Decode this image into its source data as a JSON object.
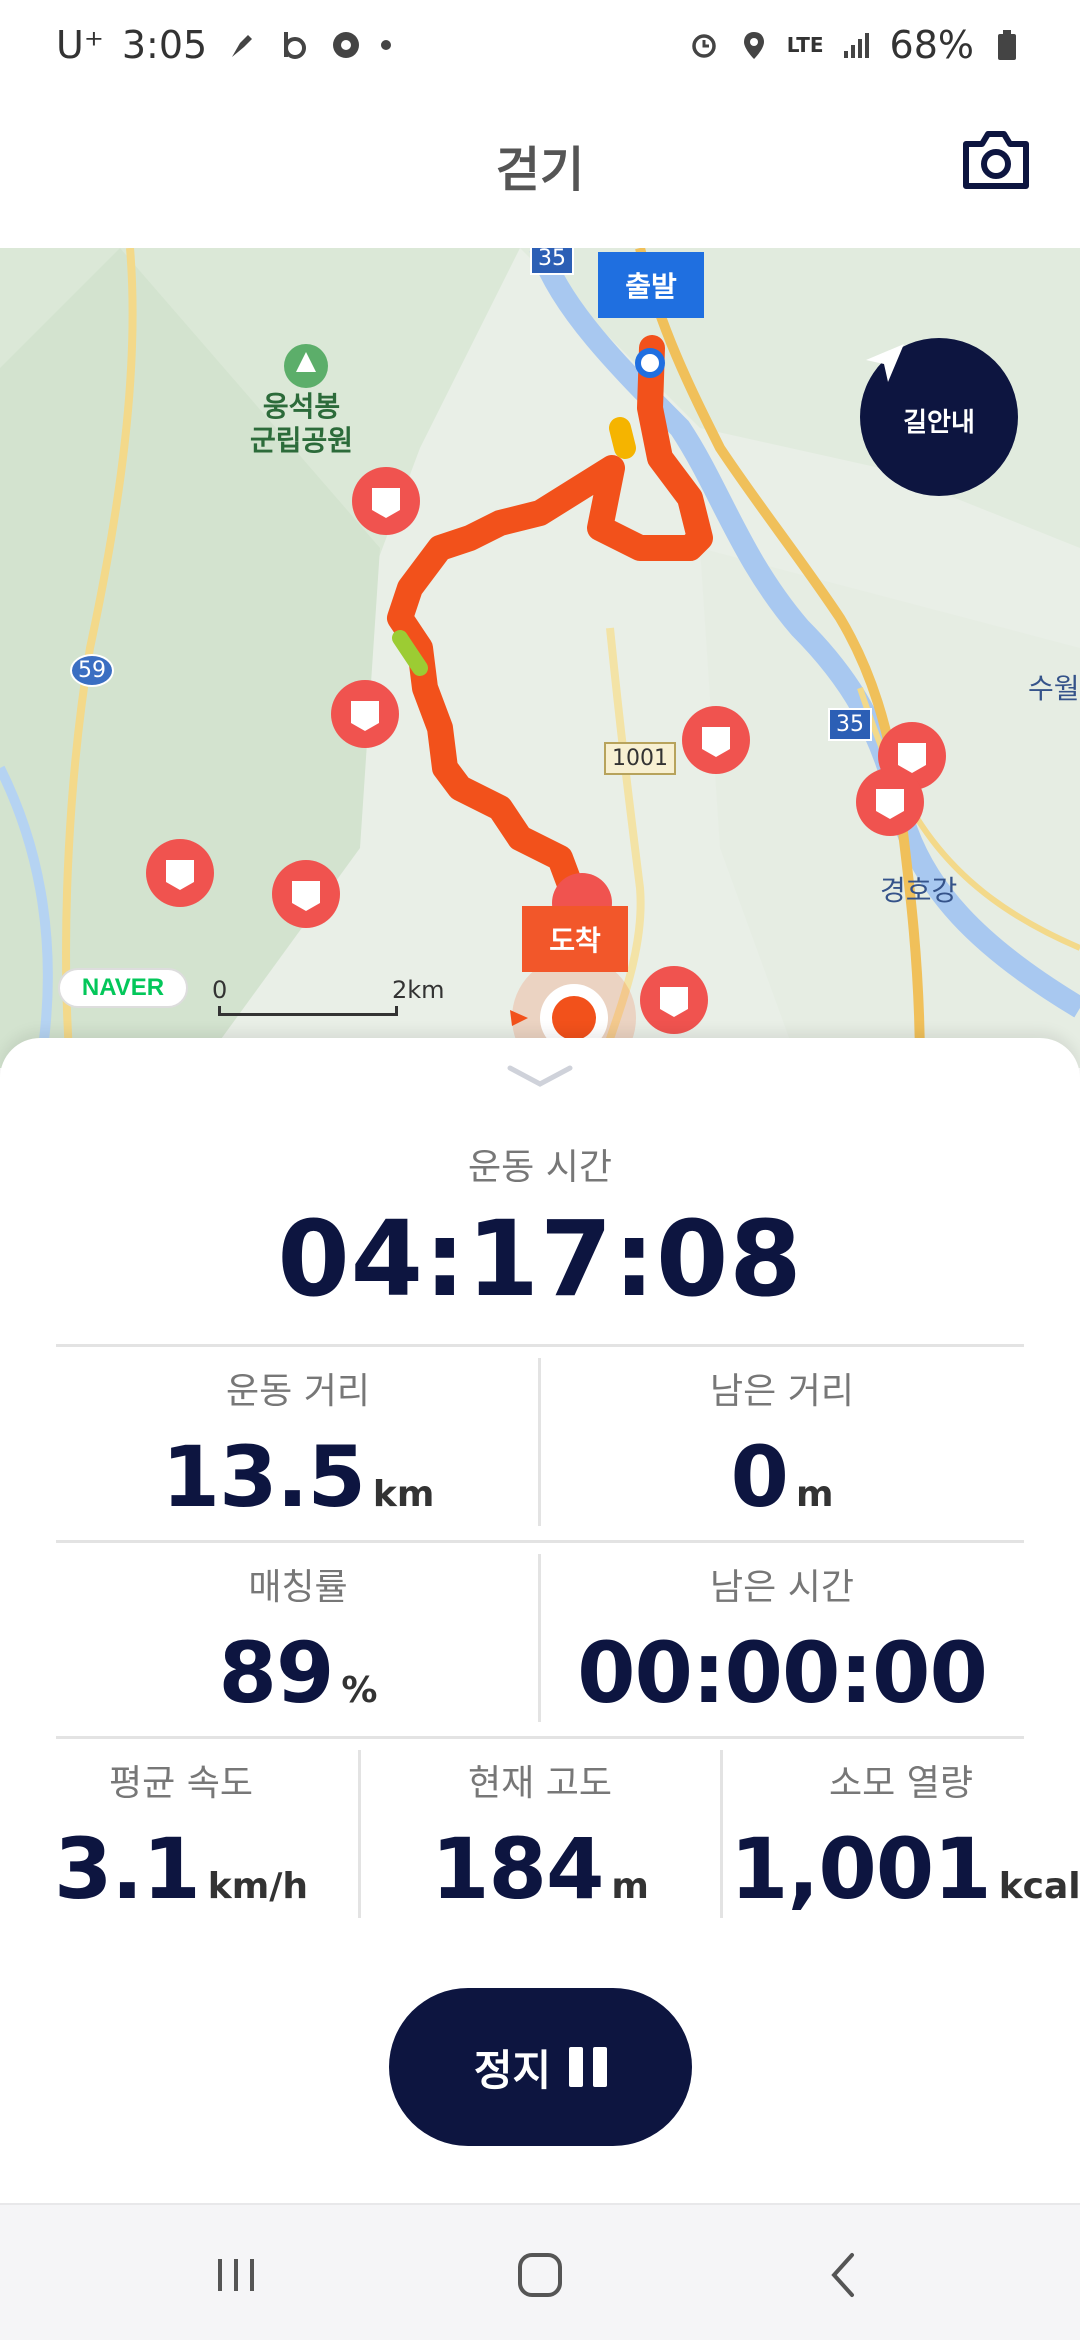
{
  "status_bar": {
    "carrier": "U⁺",
    "time": "3:05",
    "network": "LTE",
    "battery": "68%"
  },
  "header": {
    "title": "걷기",
    "camera_icon": "camera-icon"
  },
  "map": {
    "start_flag": "출발",
    "end_flag": "도착",
    "guide_button_label": "길안내",
    "provider_logo": "NAVER",
    "scale_start": "0",
    "scale_end": "2km",
    "place_park": "웅석봉\n군립공원",
    "place_river": "경호강",
    "place_edge": "수월",
    "road_59": "59",
    "road_35_top": "35",
    "road_35": "35",
    "road_1001": "1001",
    "route_color": "#f2511b"
  },
  "panel": {
    "exercise_time_label": "운동 시간",
    "exercise_time_value": "04:17:08",
    "distance_label": "운동 거리",
    "distance_value": "13.5",
    "distance_unit": "km",
    "remaining_distance_label": "남은 거리",
    "remaining_distance_value": "0",
    "remaining_distance_unit": "m",
    "matching_label": "매칭률",
    "matching_value": "89",
    "matching_unit": "%",
    "remaining_time_label": "남은 시간",
    "remaining_time_value": "00:00:00",
    "avg_speed_label": "평균 속도",
    "avg_speed_value": "3.1",
    "avg_speed_unit": "km/h",
    "altitude_label": "현재 고도",
    "altitude_value": "184",
    "altitude_unit": "m",
    "calories_label": "소모 열량",
    "calories_value": "1,001",
    "calories_unit": "kcal",
    "stop_button_label": "정지"
  },
  "colors": {
    "navy": "#0d1540",
    "route": "#f2511b",
    "start_flag": "#1f6fe0"
  }
}
